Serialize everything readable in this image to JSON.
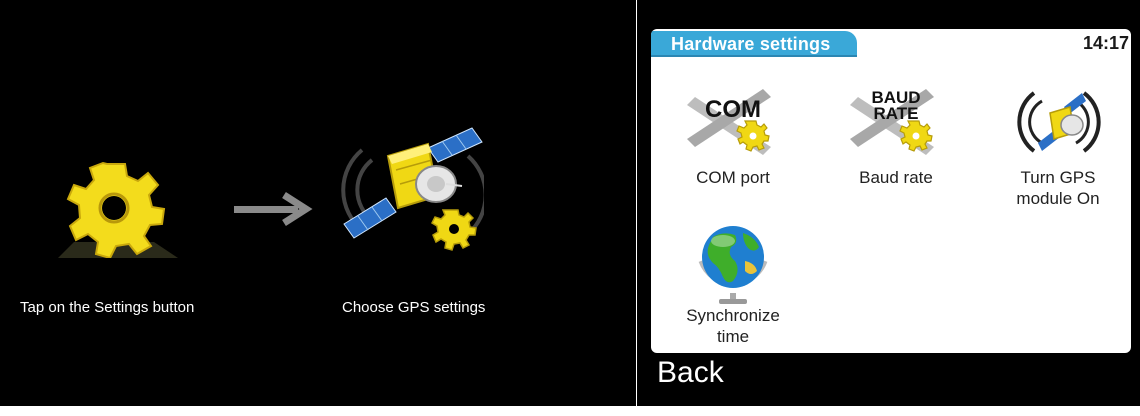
{
  "tutorial": {
    "step1": {
      "caption": "Tap on the Settings button",
      "icon": "settings-gear-icon"
    },
    "arrow": {
      "icon": "arrow-right-icon"
    },
    "step2": {
      "caption": "Choose GPS settings",
      "icon": "gps-satellite-settings-icon"
    }
  },
  "device": {
    "title": "Hardware settings",
    "clock": "14:17",
    "tiles": [
      {
        "label_line1": "COM port",
        "label_line2": "",
        "icon": "com-port-icon",
        "icon_text": "COM"
      },
      {
        "label_line1": "Baud rate",
        "label_line2": "",
        "icon": "baud-rate-icon",
        "icon_text_1": "BAUD",
        "icon_text_2": "RATE"
      },
      {
        "label_line1": "Turn GPS",
        "label_line2": "module On",
        "icon": "gps-module-icon"
      },
      {
        "label_line1": "Synchronize",
        "label_line2": "time",
        "icon": "globe-icon"
      }
    ],
    "back_label": "Back"
  },
  "colors": {
    "title_tab": "#3aa8d8",
    "gear_yellow": "#f0d814",
    "background": "#000000",
    "screen": "#ffffff"
  }
}
